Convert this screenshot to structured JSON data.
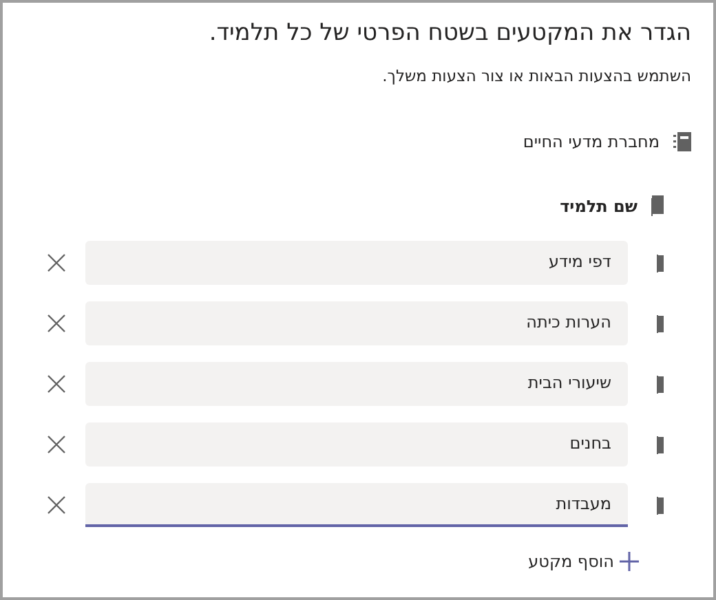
{
  "title": "הגדר את המקטעים בשטח הפרטי של כל תלמיד.",
  "subtitle": "השתמש בהצעות הבאות או צור הצעות משלך.",
  "notebook": {
    "label": "מחברת מדעי החיים"
  },
  "student": {
    "label": "שם תלמיד"
  },
  "sections": [
    {
      "value": "דפי מידע",
      "focused": false
    },
    {
      "value": "הערות כיתה",
      "focused": false
    },
    {
      "value": "שיעורי הבית",
      "focused": false
    },
    {
      "value": "בחנים",
      "focused": false
    },
    {
      "value": "מעבדות",
      "focused": true
    }
  ],
  "add_section": {
    "label": "הוסף מקטע"
  }
}
